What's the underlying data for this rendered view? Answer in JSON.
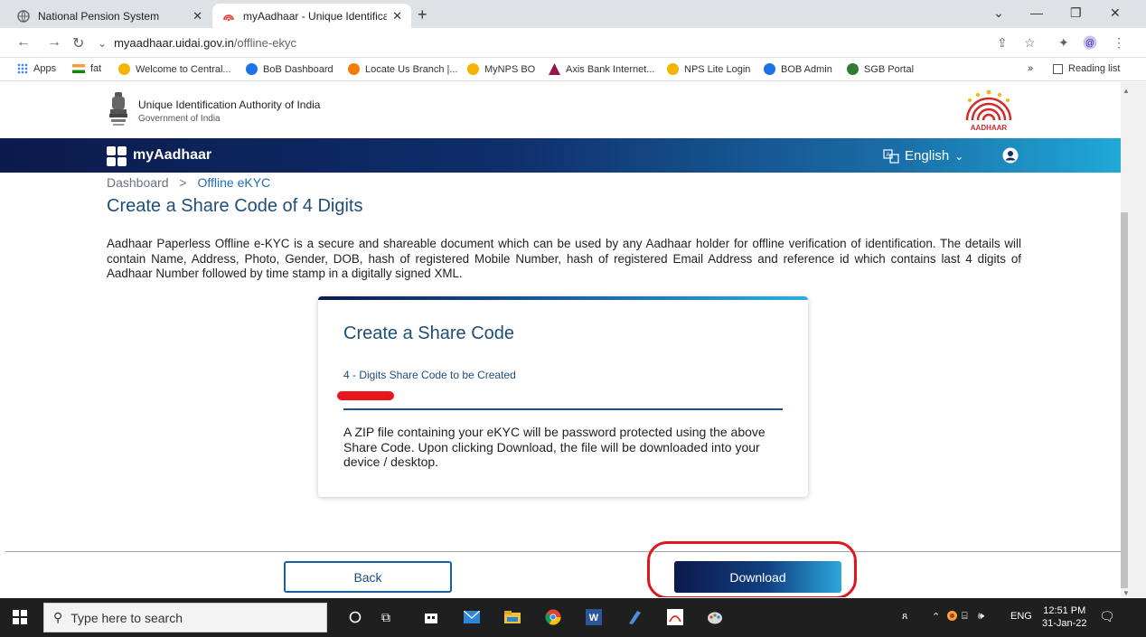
{
  "browser": {
    "tabs": [
      {
        "title": "National Pension System",
        "active": false
      },
      {
        "title": "myAadhaar - Unique Identificatio",
        "active": true
      }
    ],
    "url_host": "myaadhaar.uidai.gov.in",
    "url_path": "/offline-ekyc",
    "bookmarks": [
      {
        "label": "Apps",
        "color": "#4285f4"
      },
      {
        "label": "fat",
        "color": "#ff9933"
      },
      {
        "label": "Welcome to Central...",
        "color": "#f4b400"
      },
      {
        "label": "BoB Dashboard",
        "color": "#1a73e8"
      },
      {
        "label": "Locate Us Branch |...",
        "color": "#f57c00"
      },
      {
        "label": "MyNPS BO",
        "color": "#f4b400"
      },
      {
        "label": "Axis Bank Internet...",
        "color": "#97144d"
      },
      {
        "label": "NPS Lite Login",
        "color": "#f4b400"
      },
      {
        "label": "BOB Admin",
        "color": "#1a73e8"
      },
      {
        "label": "SGB Portal",
        "color": "#2e7d32"
      }
    ],
    "more_bookmarks": "»",
    "reading_list": "Reading list"
  },
  "gov": {
    "title": "Unique Identification Authority of India",
    "subtitle": "Government of India",
    "logo_text": "AADHAAR"
  },
  "brand": {
    "name": "myAadhaar",
    "language": "English"
  },
  "breadcrumb": {
    "root": "Dashboard",
    "separator": ">",
    "current": "Offline eKYC"
  },
  "page": {
    "title": "Create a Share Code of 4 Digits",
    "intro": "Aadhaar Paperless Offline e-KYC is a secure and shareable document which can be used by any Aadhaar holder for offline verification of identification. The details will contain Name, Address, Photo, Gender, DOB, hash of registered Mobile Number, hash of registered Email Address and reference id which contains last 4 digits of Aadhaar Number followed by time stamp in a digitally signed XML."
  },
  "card": {
    "title": "Create a Share Code",
    "field_label": "4 - Digits Share Code to be Created",
    "note": "A ZIP file containing your eKYC will be password protected using the above Share Code. Upon clicking Download, the file will be downloaded into your device / desktop."
  },
  "actions": {
    "back": "Back",
    "download": "Download"
  },
  "taskbar": {
    "search_placeholder": "Type here to search",
    "lang": "ENG",
    "time": "12:51 PM",
    "date": "31-Jan-22"
  },
  "colors": {
    "accent_dark": "#0b1a4c",
    "accent_light": "#2bb0df",
    "title_blue": "#1f4e79",
    "highlight_red": "#e0161e"
  }
}
